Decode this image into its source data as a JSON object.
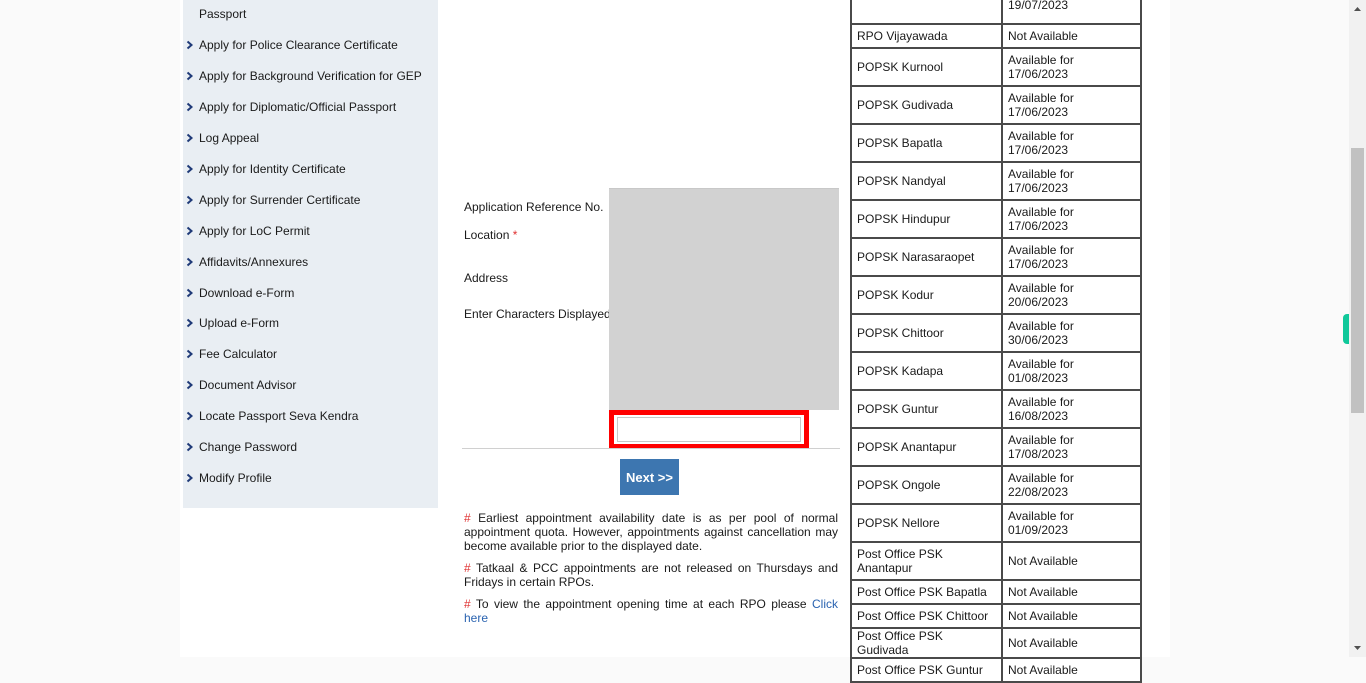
{
  "sidebar": {
    "items": [
      {
        "label": "Passport",
        "has_chevron": false
      },
      {
        "label": "Apply for Police Clearance Certificate"
      },
      {
        "label": "Apply for Background Verification for GEP"
      },
      {
        "label": "Apply for Diplomatic/Official Passport"
      },
      {
        "label": "Log Appeal"
      },
      {
        "label": "Apply for Identity Certificate"
      },
      {
        "label": "Apply for Surrender Certificate"
      },
      {
        "label": "Apply for LoC Permit"
      },
      {
        "label": "Affidavits/Annexures"
      },
      {
        "label": "Download e-Form"
      },
      {
        "label": "Upload e-Form"
      },
      {
        "label": "Fee Calculator"
      },
      {
        "label": "Document Advisor"
      },
      {
        "label": "Locate Passport Seva Kendra"
      },
      {
        "label": "Change Password"
      },
      {
        "label": "Modify Profile"
      }
    ]
  },
  "form": {
    "application_reference_label": "Application Reference No.",
    "location_label": "Location",
    "required_marker": "*",
    "address_label": "Address",
    "captcha_label": "Enter Characters Displayed",
    "captcha_value": "",
    "next_label": "Next >>"
  },
  "notes": {
    "hash": "#",
    "note1": "Earliest appointment availability date is as per pool of normal appointment quota. However, appointments against cancellation may become available prior to the displayed date.",
    "note2": "Tatkaal & PCC appointments are not released on Thursdays and Fridays in certain RPOs.",
    "note3": "To view the appointment opening time at each RPO please",
    "note3_link": "Click here"
  },
  "availability": {
    "rows": [
      {
        "location": "",
        "status": "19/07/2023"
      },
      {
        "location": "RPO Vijayawada",
        "status": "Not Available"
      },
      {
        "location": "POPSK Kurnool",
        "status": "Available for 17/06/2023"
      },
      {
        "location": "POPSK Gudivada",
        "status": "Available for 17/06/2023"
      },
      {
        "location": "POPSK Bapatla",
        "status": "Available for 17/06/2023"
      },
      {
        "location": "POPSK Nandyal",
        "status": "Available for 17/06/2023"
      },
      {
        "location": "POPSK Hindupur",
        "status": "Available for 17/06/2023"
      },
      {
        "location": "POPSK Narasaraopet",
        "status": "Available for 17/06/2023"
      },
      {
        "location": "POPSK Kodur",
        "status": "Available for 20/06/2023"
      },
      {
        "location": "POPSK Chittoor",
        "status": "Available for 30/06/2023"
      },
      {
        "location": "POPSK Kadapa",
        "status": "Available for 01/08/2023"
      },
      {
        "location": "POPSK Guntur",
        "status": "Available for 16/08/2023"
      },
      {
        "location": "POPSK Anantapur",
        "status": "Available for 17/08/2023"
      },
      {
        "location": "POPSK Ongole",
        "status": "Available for 22/08/2023"
      },
      {
        "location": "POPSK Nellore",
        "status": "Available for 01/09/2023"
      },
      {
        "location": "Post Office PSK Anantapur",
        "status": "Not Available"
      },
      {
        "location": "Post Office PSK Bapatla",
        "status": "Not Available"
      },
      {
        "location": "Post Office PSK Chittoor",
        "status": "Not Available"
      },
      {
        "location": "Post Office PSK Gudivada",
        "status": "Not Available"
      },
      {
        "location": "Post Office PSK Guntur",
        "status": "Not Available"
      }
    ]
  },
  "colors": {
    "accent": "#3d76b0",
    "highlight": "#ff0000",
    "required": "#e03131",
    "sidebar_bg": "#e9eef3",
    "chevron": "#1f3a78",
    "side_tab": "#10c89a"
  }
}
